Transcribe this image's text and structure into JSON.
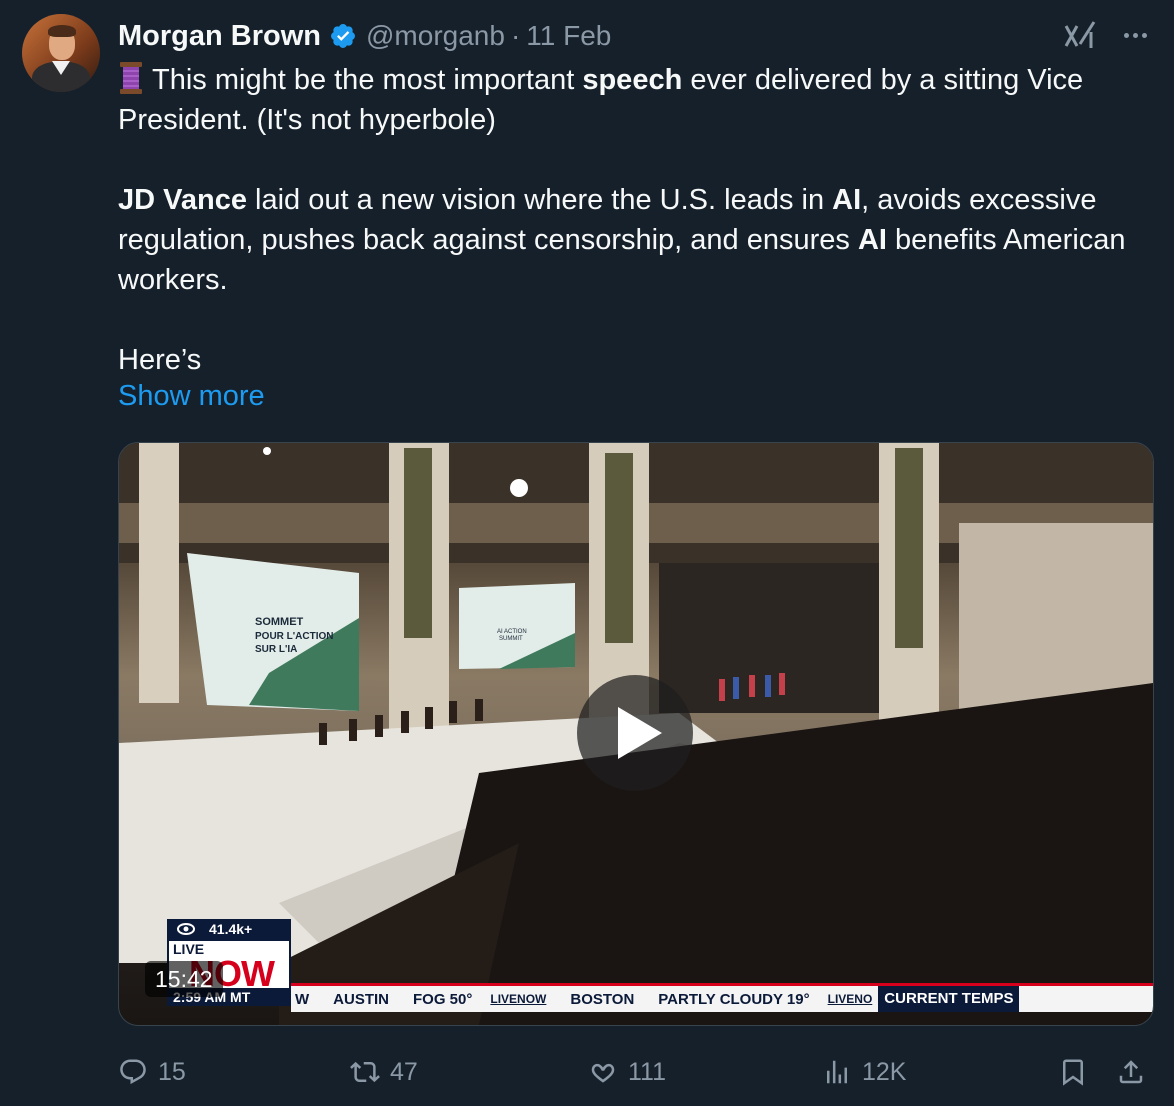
{
  "tweet": {
    "author_name": "Morgan Brown",
    "handle": "@morganb",
    "separator": "·",
    "date": "11 Feb",
    "line1_pre": "This might be the most important ",
    "line1_bold": "speech",
    "line1_post": " ever delivered by a sitting Vice President. (It's not hyperbole)",
    "p2_bold1": "JD Vance",
    "p2_a": " laid out a new vision where the U.S. leads in ",
    "p2_bold2": "AI",
    "p2_b": ", avoids excessive regulation, pushes back against censorship, and ensures ",
    "p2_bold3": "AI",
    "p2_c": " benefits American workers.",
    "p3": "Here’s",
    "show_more": "Show more"
  },
  "video": {
    "views": "41.4k+",
    "live_label": "LIVE",
    "now_label": "NOW",
    "duration": "15:42",
    "clock": "2:59 AM MT",
    "screen_left_lines": [
      "SOMMET",
      "POUR L'ACTION",
      "SUR L'IA"
    ],
    "screen_right_lines": [
      "AI ACTION",
      "SUMMIT"
    ],
    "ticker": {
      "w": "W",
      "city1": "AUSTIN",
      "cond1": "FOG 50°",
      "logo1": "LIVENOW",
      "city2": "BOSTON",
      "cond2": "PARTLY CLOUDY 19°",
      "logo2": "LIVENO",
      "current": "CURRENT TEMPS"
    }
  },
  "actions": {
    "replies": "15",
    "reposts": "47",
    "likes": "111",
    "views": "12K"
  },
  "icons": {
    "verified": "verified-badge-icon",
    "grok": "grok-icon",
    "more": "more-icon",
    "reply": "reply-icon",
    "repost": "repost-icon",
    "like": "heart-icon",
    "views": "views-icon",
    "bookmark": "bookmark-icon",
    "share": "share-icon",
    "play": "play-icon",
    "thread": "thread-spool-icon",
    "eye": "eye-icon"
  },
  "colors": {
    "background": "#15202b",
    "text": "#f7f9f9",
    "secondary": "#8b98a5",
    "link": "#1d9bf0",
    "verified": "#1d9bf0"
  }
}
